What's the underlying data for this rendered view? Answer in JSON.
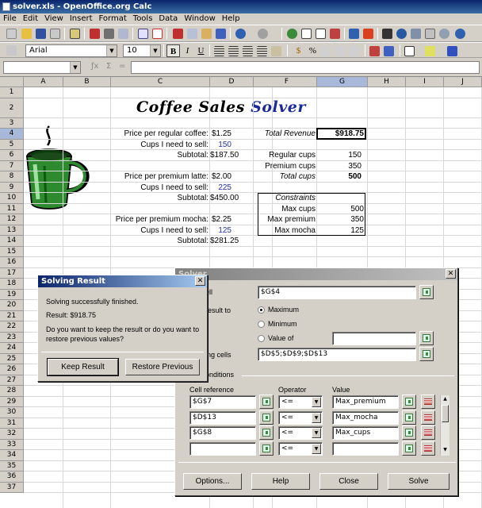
{
  "window": {
    "title": "solver.xls - OpenOffice.org Calc"
  },
  "menu": [
    "File",
    "Edit",
    "View",
    "Insert",
    "Format",
    "Tools",
    "Data",
    "Window",
    "Help"
  ],
  "format_bar": {
    "font": "Arial",
    "size": "10"
  },
  "sheet": {
    "columns": [
      "A",
      "B",
      "C",
      "D",
      "E",
      "F",
      "G",
      "H",
      "I",
      "J"
    ],
    "rows": [
      "1",
      "2",
      "3",
      "4",
      "5",
      "6",
      "7",
      "8",
      "9",
      "10",
      "11",
      "12",
      "13",
      "14",
      "15",
      "16",
      "17",
      "18",
      "19",
      "20",
      "21",
      "22",
      "23",
      "24",
      "25",
      "26",
      "27",
      "28",
      "29",
      "30",
      "31",
      "32",
      "33",
      "34",
      "35",
      "36",
      "37"
    ],
    "heading": {
      "part1": "Coffee Sales",
      "part2": "Solver"
    },
    "left_block": [
      {
        "label": "Price per regular coffee:",
        "value": "$1.25"
      },
      {
        "label": "Cups I need to sell:",
        "value": "150"
      },
      {
        "label": "Subtotal:",
        "value": "$187.50"
      },
      {
        "label": "Price per premium latte:",
        "value": "$2.00"
      },
      {
        "label": "Cups I need to sell:",
        "value": "225"
      },
      {
        "label": "Subtotal:",
        "value": "$450.00"
      },
      {
        "label": "Price per premium mocha:",
        "value": "$2.25"
      },
      {
        "label": "Cups I need to sell:",
        "value": "125"
      },
      {
        "label": "Subtotal:",
        "value": "$281.25"
      }
    ],
    "total_revenue": {
      "label": "Total Revenue",
      "value": "$918.75"
    },
    "cups": [
      {
        "label": "Regular cups",
        "value": "150"
      },
      {
        "label": "Premium cups",
        "value": "350"
      },
      {
        "label": "Total cups",
        "value": "500"
      }
    ],
    "constraints": {
      "title": "Constraints",
      "items": [
        {
          "label": "Max cups",
          "value": "500"
        },
        {
          "label": "Max premium",
          "value": "350"
        },
        {
          "label": "Max mocha",
          "value": "125"
        }
      ]
    }
  },
  "solver": {
    "title": "Solver",
    "target_label": "ell",
    "target_value": "$G$4",
    "optimize_label": "result to",
    "maximum": "Maximum",
    "minimum": "Minimum",
    "value_of": "Value of",
    "changing_label": "ing cells",
    "changing_value": "$D$5;$D$9;$D$13",
    "conditions_label": "onditions",
    "col_cell_ref": "Cell reference",
    "col_operator": "Operator",
    "col_value": "Value",
    "conditions": [
      {
        "ref": "$G$7",
        "op": "<=",
        "value": "Max_premium"
      },
      {
        "ref": "$D$13",
        "op": "<=",
        "value": "Max_mocha"
      },
      {
        "ref": "$G$8",
        "op": "<=",
        "value": "Max_cups"
      },
      {
        "ref": "",
        "op": "<=",
        "value": ""
      }
    ],
    "btn_options": "Options...",
    "btn_help": "Help",
    "btn_close": "Close",
    "btn_solve": "Solve"
  },
  "result_dialog": {
    "title": "Solving Result",
    "msg": "Solving successfully finished.",
    "result": "Result:  $918.75",
    "question": "Do you want to keep the result or do you want to restore previous values?",
    "keep": "Keep Result",
    "restore": "Restore Previous"
  }
}
